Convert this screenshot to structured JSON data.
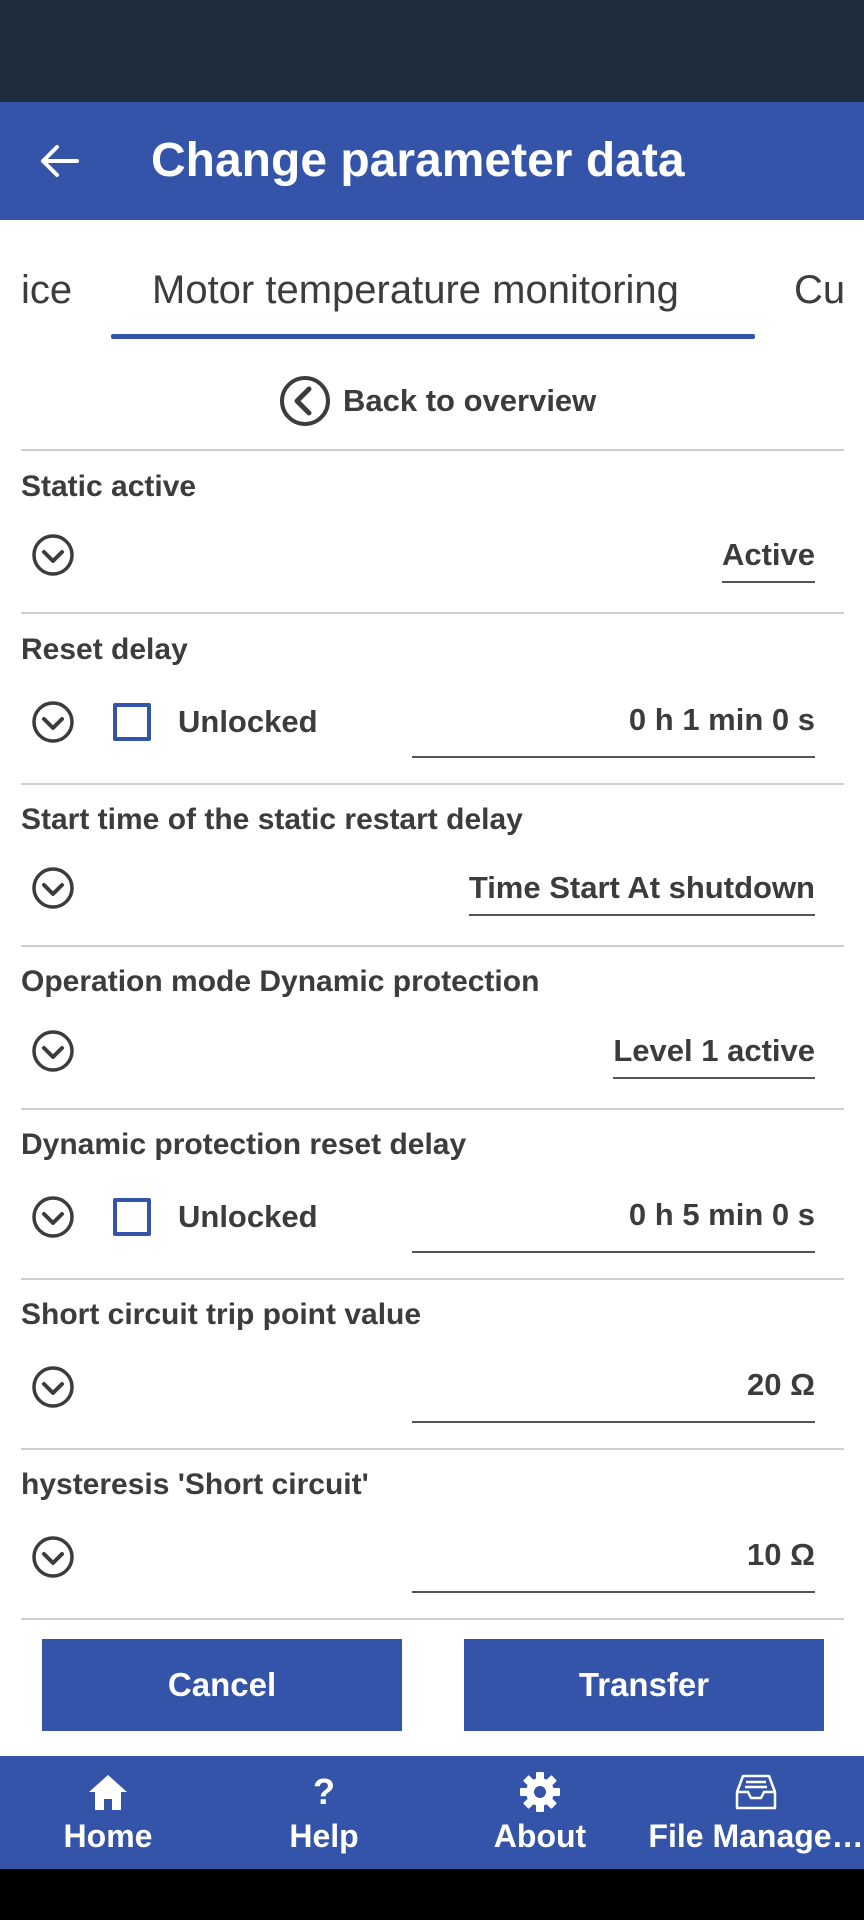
{
  "header": {
    "title": "Change parameter data"
  },
  "tabs": {
    "left": "ice",
    "active": "Motor temperature monitoring",
    "right": "Cu"
  },
  "back_overview": "Back to overview",
  "params": [
    {
      "label": "Static active",
      "value": "Active"
    },
    {
      "label": "Reset delay",
      "checkbox_label": "Unlocked",
      "checked": false,
      "value": "0 h 1 min 0 s"
    },
    {
      "label": "Start time of the static restart delay",
      "value": "Time Start At shutdown"
    },
    {
      "label": "Operation mode Dynamic protection",
      "value": "Level 1 active"
    },
    {
      "label": "Dynamic protection reset delay",
      "checkbox_label": "Unlocked",
      "checked": false,
      "value": "0 h 5 min 0 s"
    },
    {
      "label": "Short circuit trip point value",
      "value": "20 Ω"
    },
    {
      "label": "hysteresis 'Short circuit'",
      "value": "10 Ω"
    }
  ],
  "buttons": {
    "cancel": "Cancel",
    "transfer": "Transfer"
  },
  "nav": [
    {
      "label": "Home",
      "icon": "home-icon"
    },
    {
      "label": "Help",
      "icon": "help-icon"
    },
    {
      "label": "About",
      "icon": "gear-icon"
    },
    {
      "label": "File Manage…",
      "icon": "inbox-icon"
    }
  ],
  "colors": {
    "primary": "#3354a8",
    "status_bar": "#1f2d3f",
    "text": "#3c3c3c"
  }
}
